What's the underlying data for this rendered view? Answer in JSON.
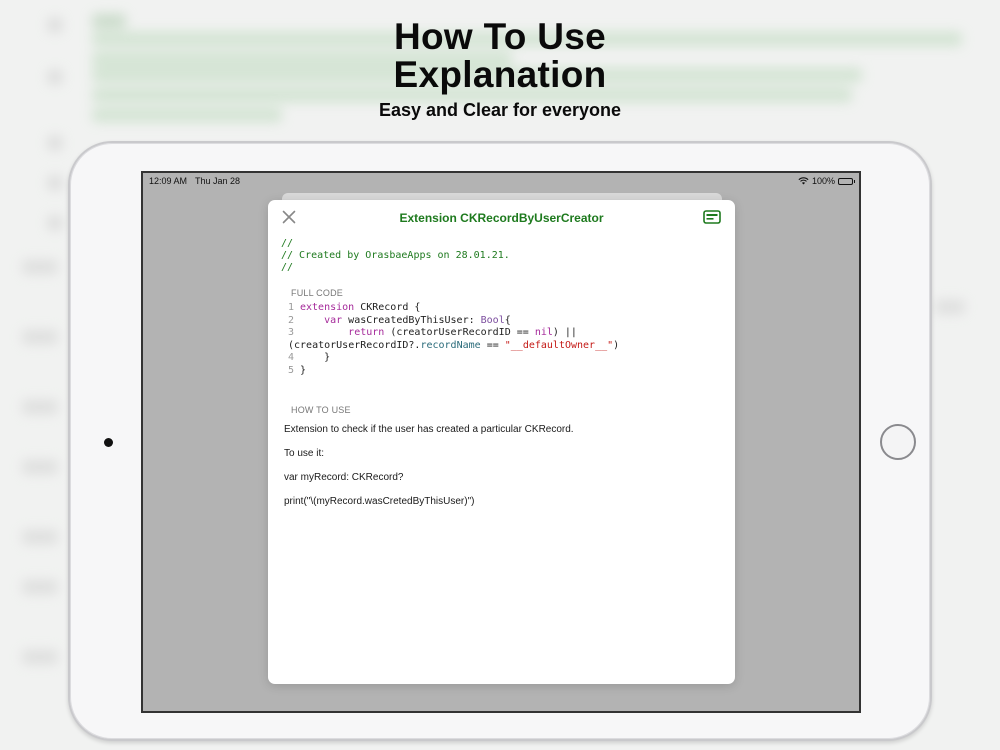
{
  "promo": {
    "headline_line1": "How To Use",
    "headline_line2": "Explanation",
    "subtitle": "Easy and Clear for everyone"
  },
  "status_bar": {
    "time": "12:09 AM",
    "date": "Thu Jan 28",
    "battery": "100%"
  },
  "modal": {
    "title": "Extension CKRecordByUserCreator",
    "comment_lines": [
      "//",
      "// Created by OrasbaeApps on 28.01.21.",
      "//"
    ],
    "full_code_label": "FULL CODE",
    "code": {
      "line_numbers": [
        "1",
        "2",
        "3",
        "4",
        "5"
      ],
      "l1_kw": "extension",
      "l1_rest": " CKRecord {",
      "l2_kw": "var",
      "l2_mid": " wasCreatedByThisUser: ",
      "l2_type": "Bool",
      "l2_end": "{",
      "l3_kw": "return",
      "l3_mid": " (creatorUserRecordID == ",
      "l3_nil": "nil",
      "l3_end": ") ||",
      "l3b_a": "(creatorUserRecordID?.",
      "l3b_prop": "recordName",
      "l3b_mid": " == ",
      "l3b_str": "\"__defaultOwner__\"",
      "l3b_end": ")",
      "l4": "}",
      "l5": "}"
    },
    "how_to_use_label": "HOW TO USE",
    "how_to_use_lines": [
      "Extension to check if the user has created a particular CKRecord.",
      "To use it:",
      "var myRecord: CKRecord?",
      "print(\"\\(myRecord.wasCretedByThisUser)\")"
    ]
  },
  "colors": {
    "accent_green": "#1e7a1e",
    "keyword": "#a52a9a",
    "string": "#c41a16"
  },
  "icons": {
    "close": "close-icon",
    "card": "card-icon",
    "wifi": "wifi-icon",
    "battery": "battery-icon"
  }
}
